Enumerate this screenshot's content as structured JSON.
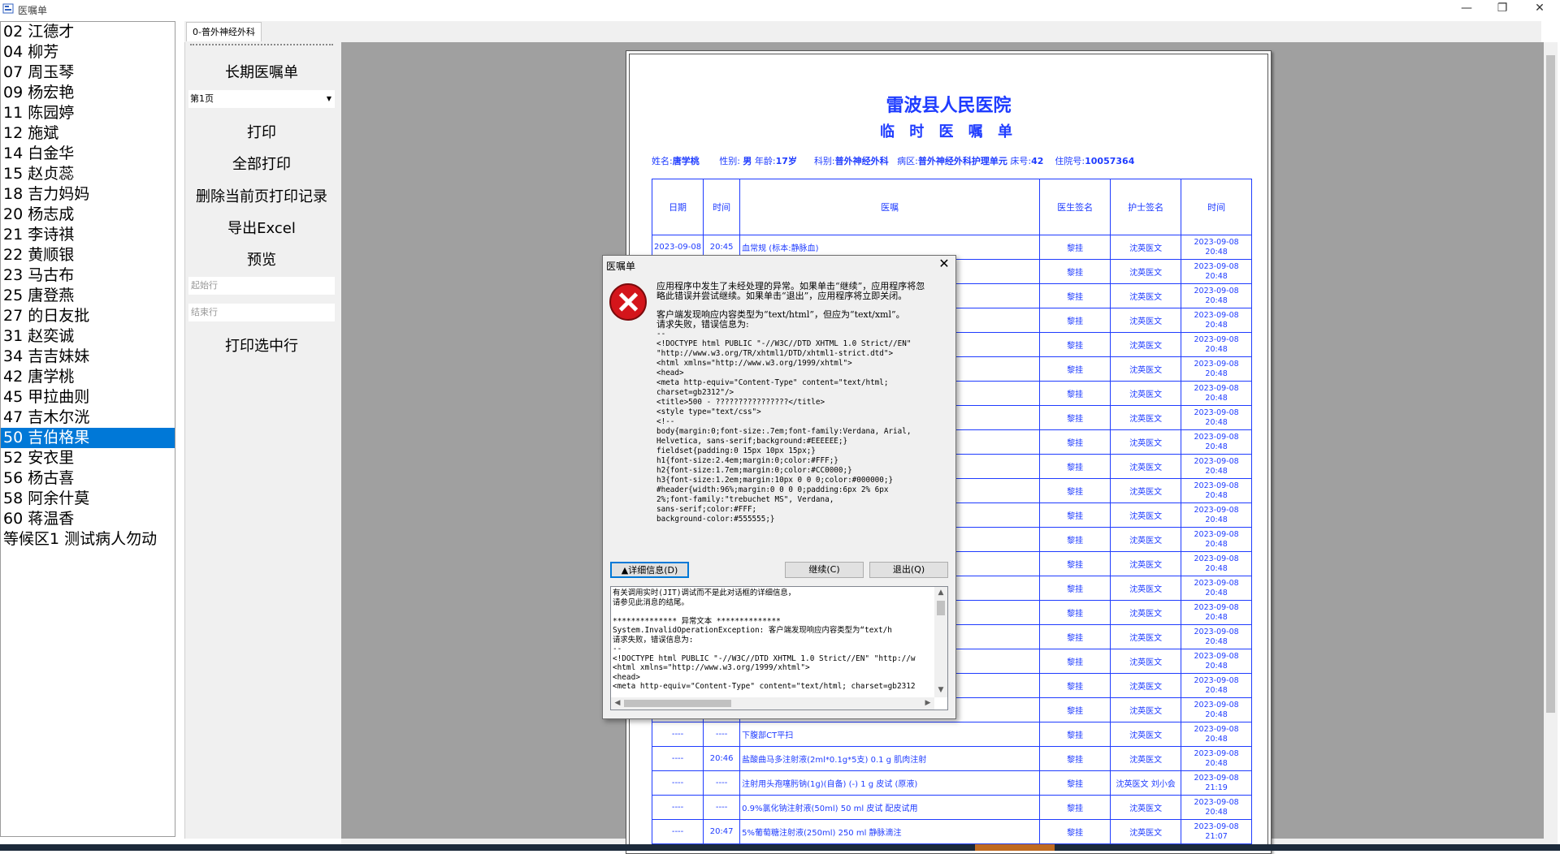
{
  "window": {
    "title": "医嘱单",
    "minimize_glyph": "—",
    "restore_glyph": "❐",
    "close_glyph": "✕"
  },
  "patients": [
    "02  江德才",
    "04  柳芳",
    "07  周玉琴",
    "09  杨宏艳",
    "11  陈园婷",
    "12  施斌",
    "14  白金华",
    "15  赵贞蕊",
    "18  吉力妈妈",
    "20  杨志成",
    "21  李诗祺",
    "22  黄顺银",
    "23  马古布",
    "25  唐登燕",
    "27  的日友批",
    "31  赵奕诚",
    "34  吉吉妹妹",
    "42  唐学桃",
    "45  甲拉曲则",
    "47  吉木尔洸",
    "50  吉伯格果",
    "52  安衣里",
    "56  杨古喜",
    "58  阿余什莫",
    "60  蒋温香",
    "等候区1 测试病人勿动"
  ],
  "selected_patient_index": 20,
  "department_tab": "0-普外神经外科",
  "side": {
    "long_term_order": "长期医嘱单",
    "page_select": "第1页",
    "print": "打印",
    "print_all": "全部打印",
    "delete_print_record": "删除当前页打印记录",
    "export_excel": "导出Excel",
    "preview": "预览",
    "start_row_placeholder": "起始行",
    "end_row_placeholder": "结束行",
    "print_selected": "打印选中行"
  },
  "document": {
    "hospital": "雷波县人民医院",
    "title": "临 时 医 嘱 单",
    "name_label": "姓名:",
    "name": "唐学桃",
    "sex_label": "性别:",
    "sex": "男",
    "age_label": "年龄:",
    "age": "17岁",
    "dept_label": "科别:",
    "dept": "普外神经外科",
    "ward_label": "病区:",
    "ward": "普外神经外科护理单元",
    "bed_label": "床号:",
    "bed": "42",
    "admission_label": "住院号:",
    "admission_no": "10057364",
    "columns": [
      "日期",
      "时间",
      "医嘱",
      "医生签名",
      "护士签名",
      "时间"
    ],
    "rows": [
      {
        "date": "2023-09-08",
        "time": "20:45",
        "order": "血常规  (标本:静脉血)",
        "doctor": "黎挂",
        "nurse": "沈英医文",
        "ts1": "2023-09-08",
        "ts2": "20:48"
      },
      {
        "date": "",
        "time": "",
        "order": "",
        "doctor": "黎挂",
        "nurse": "沈英医文",
        "ts1": "2023-09-08",
        "ts2": "20:48"
      },
      {
        "date": "",
        "time": "",
        "order": "",
        "doctor": "黎挂",
        "nurse": "沈英医文",
        "ts1": "2023-09-08",
        "ts2": "20:48"
      },
      {
        "date": "",
        "time": "",
        "order": "",
        "doctor": "黎挂",
        "nurse": "沈英医文",
        "ts1": "2023-09-08",
        "ts2": "20:48"
      },
      {
        "date": "",
        "time": "",
        "order": "",
        "doctor": "黎挂",
        "nurse": "沈英医文",
        "ts1": "2023-09-08",
        "ts2": "20:48"
      },
      {
        "date": "",
        "time": "",
        "order": "",
        "doctor": "黎挂",
        "nurse": "沈英医文",
        "ts1": "2023-09-08",
        "ts2": "20:48"
      },
      {
        "date": "",
        "time": "",
        "order": "",
        "doctor": "黎挂",
        "nurse": "沈英医文",
        "ts1": "2023-09-08",
        "ts2": "20:48"
      },
      {
        "date": "",
        "time": "",
        "order": "",
        "doctor": "黎挂",
        "nurse": "沈英医文",
        "ts1": "2023-09-08",
        "ts2": "20:48"
      },
      {
        "date": "",
        "time": "",
        "order": "",
        "doctor": "黎挂",
        "nurse": "沈英医文",
        "ts1": "2023-09-08",
        "ts2": "20:48"
      },
      {
        "date": "",
        "time": "",
        "order": "",
        "doctor": "黎挂",
        "nurse": "沈英医文",
        "ts1": "2023-09-08",
        "ts2": "20:48"
      },
      {
        "date": "",
        "time": "",
        "order": "",
        "doctor": "黎挂",
        "nurse": "沈英医文",
        "ts1": "2023-09-08",
        "ts2": "20:48"
      },
      {
        "date": "",
        "time": "",
        "order": "",
        "doctor": "黎挂",
        "nurse": "沈英医文",
        "ts1": "2023-09-08",
        "ts2": "20:48"
      },
      {
        "date": "",
        "time": "",
        "order": "",
        "doctor": "黎挂",
        "nurse": "沈英医文",
        "ts1": "2023-09-08",
        "ts2": "20:48"
      },
      {
        "date": "",
        "time": "",
        "order": "",
        "doctor": "黎挂",
        "nurse": "沈英医文",
        "ts1": "2023-09-08",
        "ts2": "20:48"
      },
      {
        "date": "",
        "time": "",
        "order": "",
        "doctor": "黎挂",
        "nurse": "沈英医文",
        "ts1": "2023-09-08",
        "ts2": "20:48"
      },
      {
        "date": "",
        "time": "",
        "order": "",
        "doctor": "黎挂",
        "nurse": "沈英医文",
        "ts1": "2023-09-08",
        "ts2": "20:48"
      },
      {
        "date": "",
        "time": "",
        "order": "",
        "doctor": "黎挂",
        "nurse": "沈英医文",
        "ts1": "2023-09-08",
        "ts2": "20:48"
      },
      {
        "date": "",
        "time": "",
        "order": "",
        "doctor": "黎挂",
        "nurse": "沈英医文",
        "ts1": "2023-09-08",
        "ts2": "20:48"
      },
      {
        "date": "",
        "time": "",
        "order": "",
        "doctor": "黎挂",
        "nurse": "沈英医文",
        "ts1": "2023-09-08",
        "ts2": "20:48"
      },
      {
        "date": "",
        "time": "",
        "order": "",
        "doctor": "黎挂",
        "nurse": "沈英医文",
        "ts1": "2023-09-08",
        "ts2": "20:48"
      },
      {
        "date": "----",
        "time": "----",
        "order": "下腹部CT平扫",
        "doctor": "黎挂",
        "nurse": "沈英医文",
        "ts1": "2023-09-08",
        "ts2": "20:48"
      },
      {
        "date": "----",
        "time": "20:46",
        "order": "盐酸曲马多注射液(2ml*0.1g*5支)  0.1 g 肌肉注射",
        "doctor": "黎挂",
        "nurse": "沈英医文",
        "ts1": "2023-09-08",
        "ts2": "20:48"
      },
      {
        "date": "----",
        "time": "----",
        "order": "注射用头孢噻肟钠(1g)(自备) (-) 1 g 皮试 (原液)",
        "doctor": "黎挂",
        "nurse": "沈英医文  刘小会",
        "ts1": "2023-09-08",
        "ts2": "21:19"
      },
      {
        "date": "----",
        "time": "----",
        "order": "0.9%氯化钠注射液(50ml)  50 ml 皮试   配皮试用",
        "doctor": "黎挂",
        "nurse": "沈英医文",
        "ts1": "2023-09-08",
        "ts2": "20:48"
      },
      {
        "date": "----",
        "time": "20:47",
        "order": "5%葡萄糖注射液(250ml)  250 ml 静脉滴注",
        "doctor": "黎挂",
        "nurse": "沈英医文",
        "ts1": "2023-09-08",
        "ts2": "21:07"
      }
    ]
  },
  "dialog": {
    "title": "医嘱单",
    "close_glyph": "✕",
    "message1": "应用程序中发生了未经处理的异常。如果单击“继续”，应用程序将忽略此错误并尝试继续。如果单击“退出”，应用程序将立即关闭。",
    "message2": "客户端发现响应内容类型为“text/html”，但应为“text/xml”。",
    "message3": "请求失败，错误信息为:",
    "html_dump": "--\n<!DOCTYPE html PUBLIC \"-//W3C//DTD XHTML 1.0 Strict//EN\"\n\"http://www.w3.org/TR/xhtml1/DTD/xhtml1-strict.dtd\">\n<html xmlns=\"http://www.w3.org/1999/xhtml\">\n<head>\n<meta http-equiv=\"Content-Type\" content=\"text/html;\ncharset=gb2312\"/>\n<title>500 - ????????????????</title>\n<style type=\"text/css\">\n<!--\nbody{margin:0;font-size:.7em;font-family:Verdana, Arial,\nHelvetica, sans-serif;background:#EEEEEE;}\nfieldset{padding:0 15px 10px 15px;}\nh1{font-size:2.4em;margin:0;color:#FFF;}\nh2{font-size:1.7em;margin:0;color:#CC0000;}\nh3{font-size:1.2em;margin:10px 0 0 0;color:#000000;}\n#header{width:96%;margin:0 0 0 0;padding:6px 2% 6px\n2%;font-family:\"trebuchet MS\", Verdana,\nsans-serif;color:#FFF;\nbackground-color:#555555;}",
    "details_button": "▲详细信息(D)",
    "continue_button": "继续(C)",
    "quit_button": "退出(Q)",
    "details_text": "有关调用实时(JIT)调试而不是此对话框的详细信息，\n请参见此消息的结尾。\n\n************** 异常文本 **************\nSystem.InvalidOperationException: 客户端发现响应内容类型为“text/h\n请求失败，错误信息为:\n--\n<!DOCTYPE html PUBLIC \"-//W3C//DTD XHTML 1.0 Strict//EN\" \"http://w\n<html xmlns=\"http://www.w3.org/1999/xhtml\">\n<head>\n<meta http-equiv=\"Content-Type\" content=\"text/html; charset=gb2312"
  }
}
